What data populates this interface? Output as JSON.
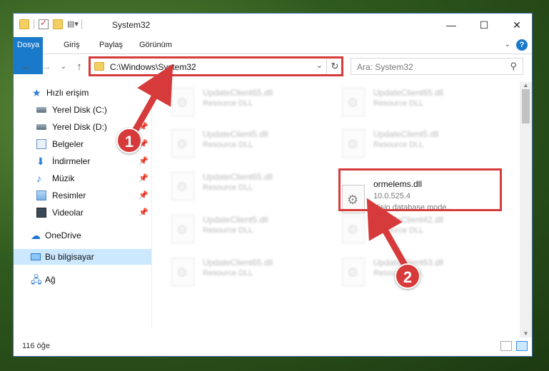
{
  "titlebar": {
    "title": "System32",
    "controls": {
      "minimize": "—",
      "maximize": "☐",
      "close": "✕"
    }
  },
  "ribbon": {
    "tabs": [
      "Dosya",
      "Giriş",
      "Paylaş",
      "Görünüm"
    ],
    "help": "?"
  },
  "nav": {
    "address": "C:\\Windows\\System32",
    "search_placeholder": "Ara: System32"
  },
  "sidebar": {
    "items": [
      {
        "label": "Hızlı erişim",
        "icon": "star-icon"
      },
      {
        "label": "Yerel Disk (C:)",
        "icon": "drive-icon"
      },
      {
        "label": "Yerel Disk (D:)",
        "icon": "drive-icon"
      },
      {
        "label": "Belgeler",
        "icon": "documents-icon"
      },
      {
        "label": "İndirmeler",
        "icon": "download-icon"
      },
      {
        "label": "Müzik",
        "icon": "music-icon"
      },
      {
        "label": "Resimler",
        "icon": "pictures-icon"
      },
      {
        "label": "Videolar",
        "icon": "video-icon"
      },
      {
        "label": "OneDrive",
        "icon": "cloud-icon"
      },
      {
        "label": "Bu bilgisayar",
        "icon": "computer-icon"
      },
      {
        "label": "Ağ",
        "icon": "network-icon"
      }
    ]
  },
  "files": [
    {
      "name": "UpdateClient65.dll",
      "sub": "Resource DLL"
    },
    {
      "name": "UpdateClient65.dll",
      "sub": "Resource DLL"
    },
    {
      "name": "UpdateClient5.dll",
      "sub": "Resource DLL"
    },
    {
      "name": "UpdateClient5.dll",
      "sub": "Resource DLL"
    },
    {
      "name": "UpdateClient65.dll",
      "sub": "Resource DLL"
    },
    {
      "name": "ormelems.dll",
      "sub": "10.0.525.4",
      "sub2": "Visio database mode..."
    },
    {
      "name": "UpdateClient5.dll",
      "sub": "Resource DLL"
    },
    {
      "name": "UpdateClient42.dll",
      "sub": "Resource DLL"
    },
    {
      "name": "UpdateClient65.dll",
      "sub": "Resource DLL"
    },
    {
      "name": "UpdateClient63.dll",
      "sub": "Resource DLL"
    }
  ],
  "status": {
    "count": "116 öğe"
  },
  "annotations": {
    "badge1": "1",
    "badge2": "2"
  },
  "colors": {
    "accent": "#1979ca",
    "annotation": "#d63a3a",
    "selection": "#cce8ff"
  }
}
